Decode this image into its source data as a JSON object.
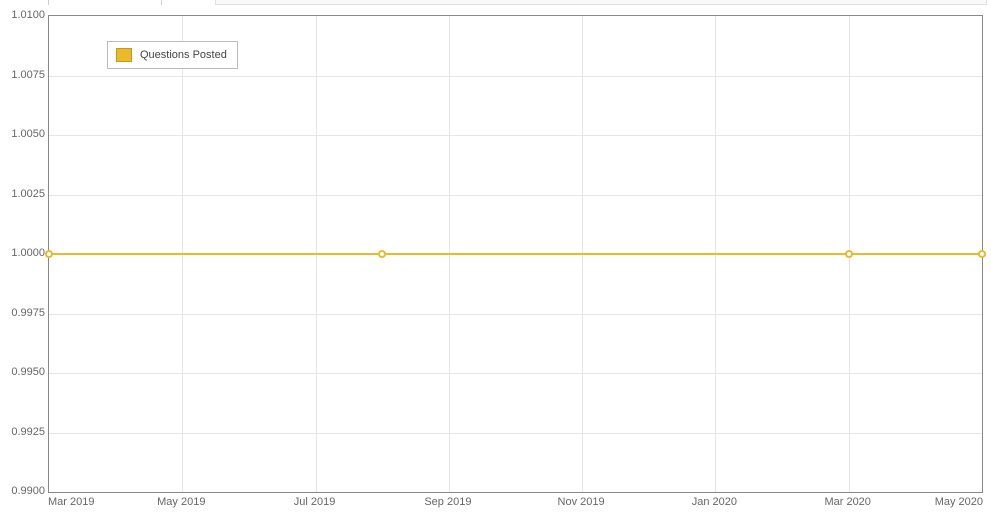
{
  "legend": {
    "label": "Questions Posted"
  },
  "axes": {
    "y": {
      "ticks": [
        "1.0100",
        "1.0075",
        "1.0050",
        "1.0025",
        "1.0000",
        "0.9975",
        "0.9950",
        "0.9925",
        "0.9900"
      ]
    },
    "x": {
      "ticks": [
        "Mar 2019",
        "May 2019",
        "Jul 2019",
        "Sep 2019",
        "Nov 2019",
        "Jan 2020",
        "Mar 2020",
        "May 2020"
      ]
    }
  },
  "chart_data": {
    "type": "line",
    "title": "",
    "xlabel": "",
    "ylabel": "",
    "ylim": [
      0.99,
      1.01
    ],
    "x_range": [
      "Mar 2019",
      "May 2020"
    ],
    "series": [
      {
        "name": "Questions Posted",
        "color": "#e9b92e",
        "points": [
          {
            "x": "Mar 2019",
            "y": 1.0
          },
          {
            "x": "Aug 2019",
            "y": 1.0
          },
          {
            "x": "Mar 2020",
            "y": 1.0
          },
          {
            "x": "May 2020",
            "y": 1.0
          }
        ]
      }
    ]
  }
}
